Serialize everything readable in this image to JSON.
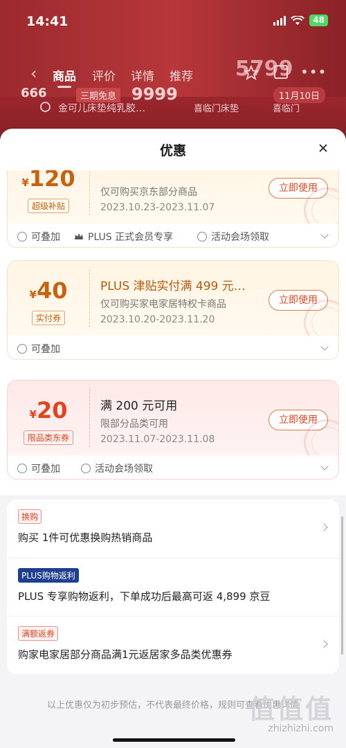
{
  "status_bar": {
    "time": "14:41",
    "battery": "48"
  },
  "background_page": {
    "tabs": [
      "商品",
      "评价",
      "详情",
      "推荐"
    ],
    "price_display": "5799",
    "price_strip": {
      "left": "666",
      "badge": "三期免息",
      "price": "9999",
      "date_badge": "11月10日"
    },
    "search_text": "金可儿床垫纯乳胶…",
    "search_keywords": [
      "喜临门床垫",
      "喜临门"
    ]
  },
  "sheet": {
    "title": "优惠",
    "coupons": [
      {
        "currency": "¥",
        "amount": "120",
        "tag": "超级补贴",
        "title": "",
        "desc": "仅可购买京东部分商品",
        "date": "2023.10.23-2023.11.07",
        "button": "立即使用",
        "features": [
          "可叠加",
          "PLUS 正式会员专享",
          "活动会场领取"
        ]
      },
      {
        "currency": "¥",
        "amount": "40",
        "tag": "实付券",
        "title": "PLUS 津贴实付满 499 元…",
        "desc": "仅可购买家电家居特权卡商品",
        "date": "2023.10.20-2023.11.20",
        "button": "立即使用",
        "features": [
          "可叠加"
        ]
      },
      {
        "currency": "¥",
        "amount": "20",
        "tag": "限品类东券",
        "title": "满 200 元可用",
        "desc": "限部分品类可用",
        "date": "2023.11.07-2023.11.08",
        "button": "立即使用",
        "features": [
          "可叠加",
          "活动会场领取"
        ]
      }
    ],
    "promotions": [
      {
        "tag": "换购",
        "text": "购买 1件可优惠换购热销商品"
      },
      {
        "tag": "PLUS购物返利",
        "text": "PLUS 专享购物返利，下单成功后最高可返 4,899 京豆"
      },
      {
        "tag": "满额返券",
        "text": "购家电家居部分商品满1元返居家多品类优惠券"
      }
    ],
    "footnote": "以上优惠仅为初步预估，不代表最终价格，规则可查看优惠详情"
  },
  "watermark": {
    "logo": "值值值",
    "url": "zhizhizhi.com"
  },
  "colors": {
    "accent": "#e4441c",
    "gold": "#c8620f",
    "plus_blue": "#1e3f8f"
  }
}
